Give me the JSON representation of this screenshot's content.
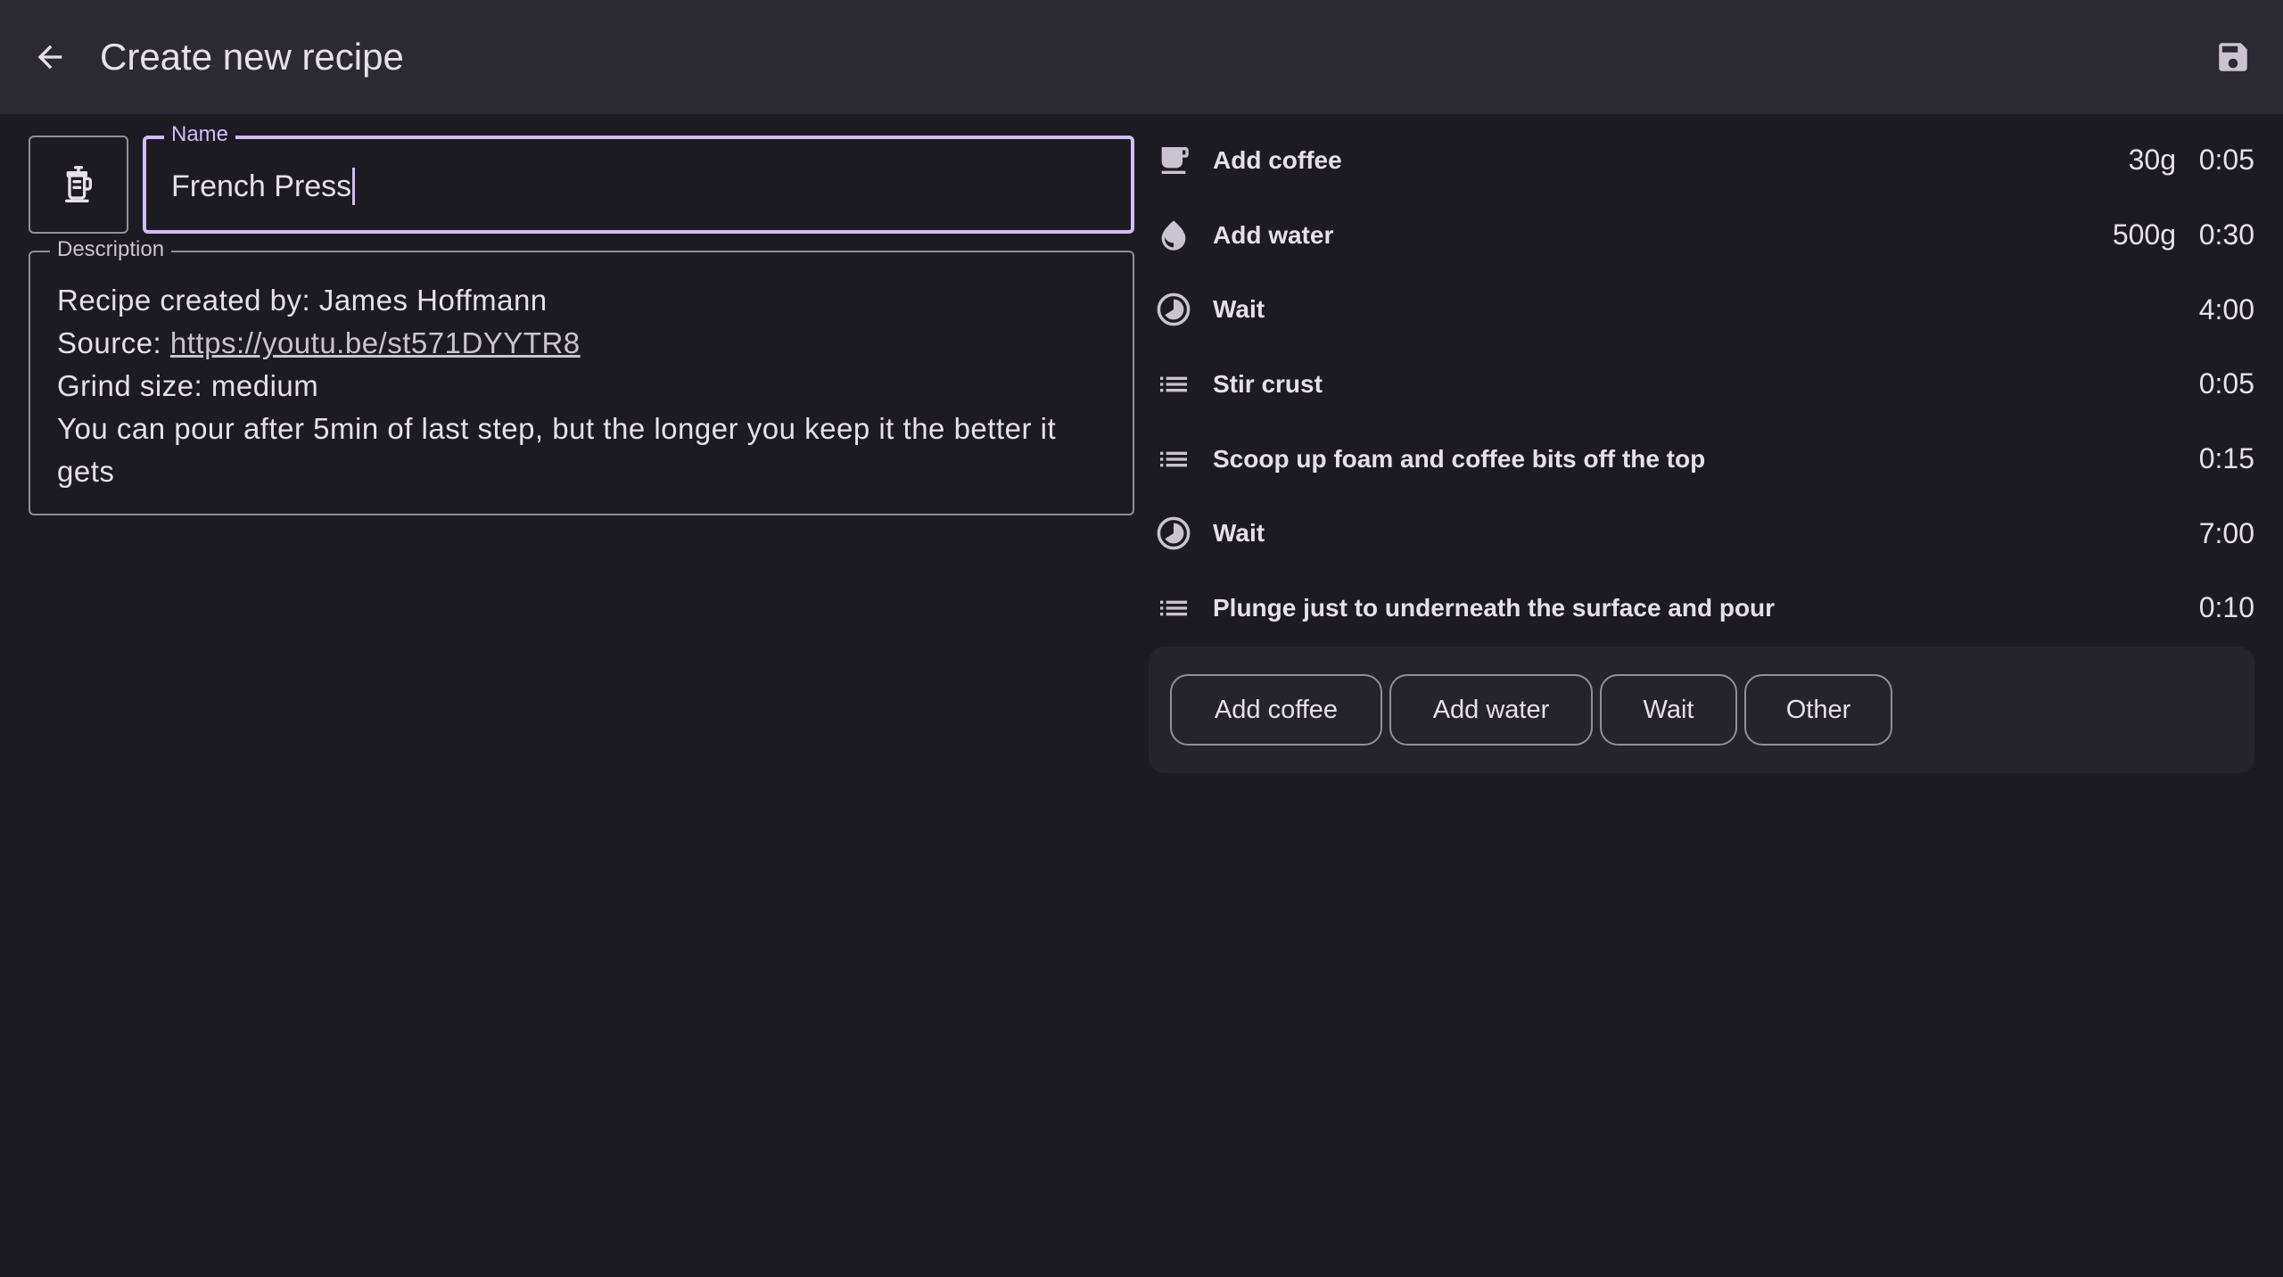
{
  "appbar": {
    "title": "Create new recipe",
    "back_icon": "arrow-back-icon",
    "save_icon": "floppy-disk-icon"
  },
  "recipe_icon": "french-press-icon",
  "name_field": {
    "label": "Name",
    "value": "French Press"
  },
  "description_field": {
    "label": "Description",
    "line1": "Recipe created by: James Hoffmann",
    "source_prefix": "Source: ",
    "source_link": "https://youtu.be/st571DYYTR8",
    "line3": "Grind size: medium",
    "line4": "You can pour after 5min of last step, but the longer you keep it the better it gets"
  },
  "steps": [
    {
      "icon": "coffee-cup-icon",
      "label": "Add coffee",
      "amount": "30g",
      "time": "0:05"
    },
    {
      "icon": "water-drop-icon",
      "label": "Add water",
      "amount": "500g",
      "time": "0:30"
    },
    {
      "icon": "timer-icon",
      "label": "Wait",
      "amount": "",
      "time": "4:00"
    },
    {
      "icon": "list-icon",
      "label": "Stir crust",
      "amount": "",
      "time": "0:05"
    },
    {
      "icon": "list-icon",
      "label": "Scoop up foam and coffee bits off the top",
      "amount": "",
      "time": "0:15"
    },
    {
      "icon": "timer-icon",
      "label": "Wait",
      "amount": "",
      "time": "7:00"
    },
    {
      "icon": "list-icon",
      "label": "Plunge just to underneath the surface and pour",
      "amount": "",
      "time": "0:10"
    }
  ],
  "add_buttons": {
    "coffee": "Add coffee",
    "water": "Add water",
    "wait": "Wait",
    "other": "Other"
  },
  "colors": {
    "background": "#1c1b21",
    "appbar": "#2b2a33",
    "accent": "#cfbdfe",
    "outline": "#938f99"
  }
}
